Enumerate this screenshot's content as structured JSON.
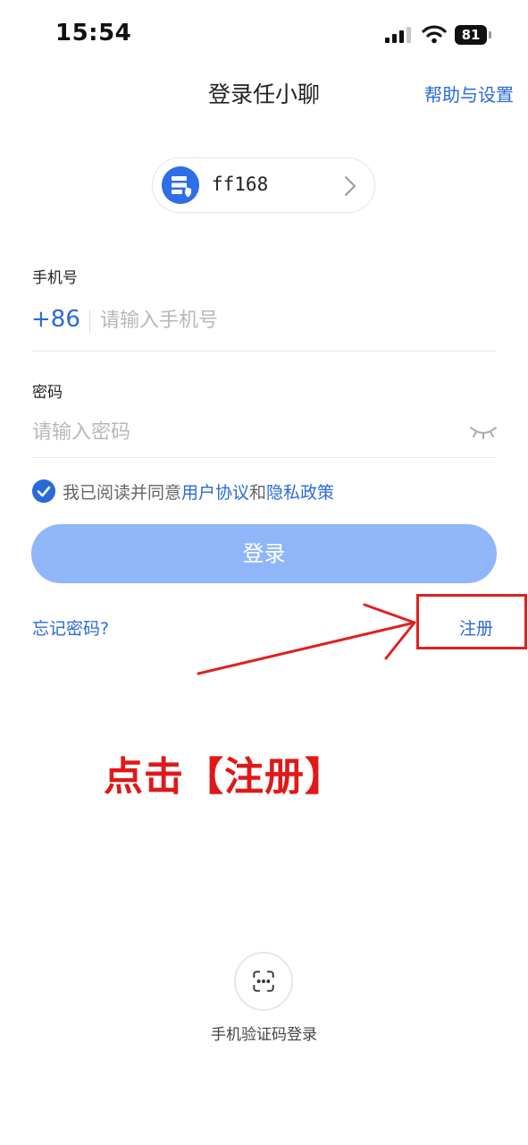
{
  "status_bar": {
    "time": "15:54",
    "battery": "81",
    "icons": [
      "signal-icon",
      "wifi-icon",
      "battery-icon"
    ]
  },
  "header": {
    "title": "登录任小聊",
    "help_settings": "帮助与设置"
  },
  "server": {
    "name": "ff168",
    "icon": "server-icon"
  },
  "form": {
    "phone_label": "手机号",
    "country_code": "+86",
    "phone_placeholder": "请输入手机号",
    "password_label": "密码",
    "password_placeholder": "请输入密码"
  },
  "agreement": {
    "checked": true,
    "prefix": "我已阅读并同意",
    "user_agreement": "用户协议",
    "and": "和",
    "privacy_policy": "隐私政策"
  },
  "buttons": {
    "login": "登录",
    "forgot_password": "忘记密码?",
    "register": "注册"
  },
  "annotation": {
    "text": "点击【注册】",
    "color": "#e02020"
  },
  "sms_login": {
    "label": "手机验证码登录",
    "icon": "sms-icon"
  },
  "colors": {
    "accent": "#2a6ad8",
    "login_button": "#8fb6f8"
  }
}
